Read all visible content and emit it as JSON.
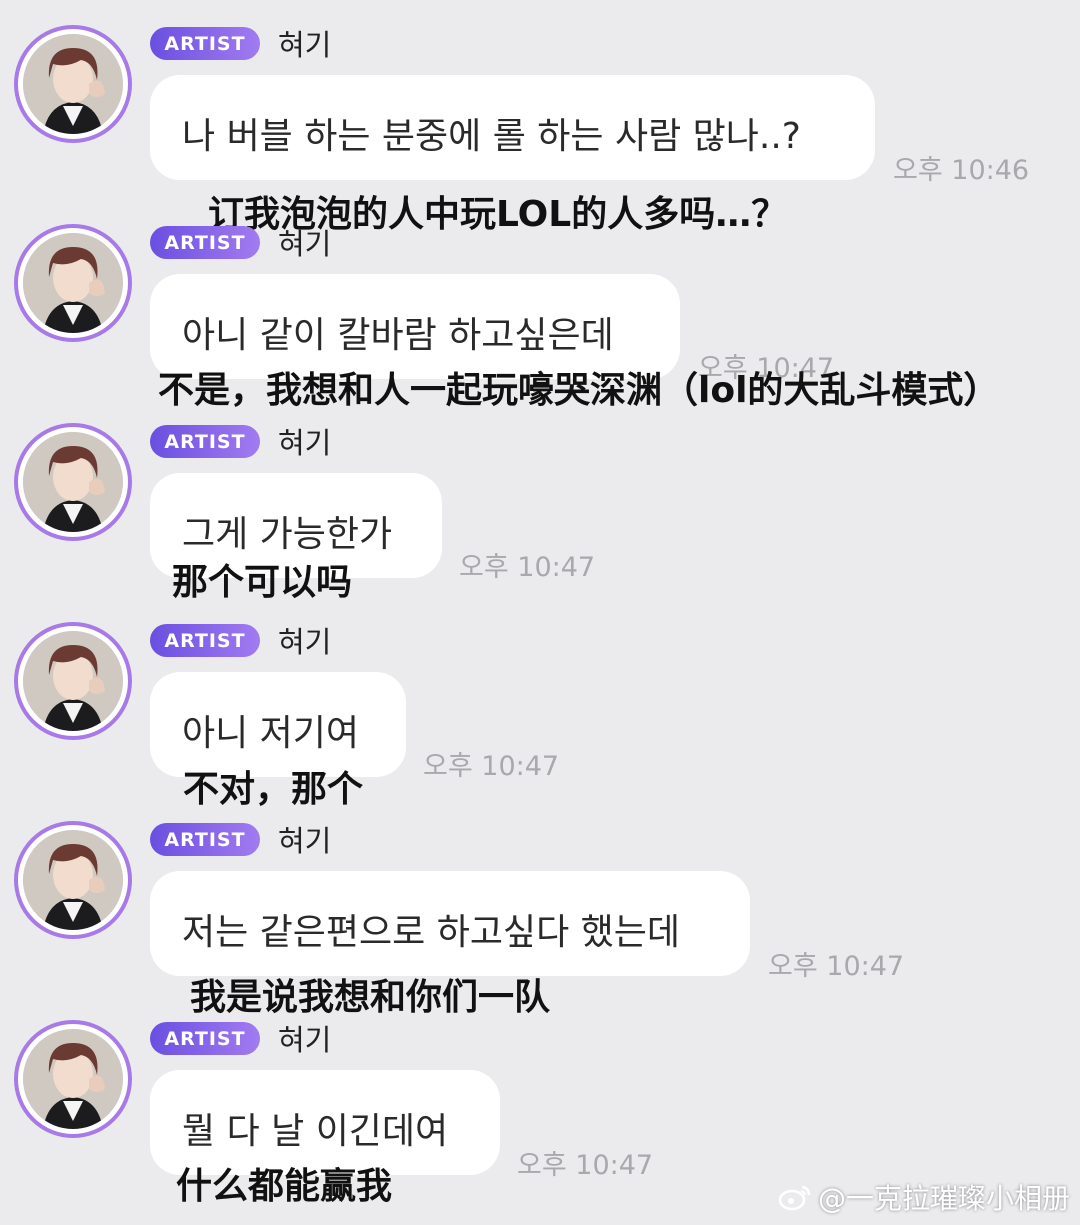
{
  "colors": {
    "badge_start": "#6a4fe0",
    "badge_end": "#a27bf0",
    "avatar_ring": "#a77ae8",
    "background": "#ebebee"
  },
  "messages": [
    {
      "badge": "ARTIST",
      "name": "혀기",
      "text": "나 버블 하는 분중에 롤 하는 사람 많나..?",
      "time": "오후 10:46",
      "translation": "订我泡泡的人中玩LOL的人多吗…？"
    },
    {
      "badge": "ARTIST",
      "name": "혀기",
      "text": "아니 같이 칼바람 하고싶은데",
      "time": "오후 10:47",
      "translation": "不是，我想和人一起玩嚎哭深渊（lol的大乱斗模式）"
    },
    {
      "badge": "ARTIST",
      "name": "혀기",
      "text": "그게 가능한가",
      "time": "오후 10:47",
      "translation": "那个可以吗"
    },
    {
      "badge": "ARTIST",
      "name": "혀기",
      "text": "아니 저기여",
      "time": "오후 10:47",
      "translation": "不对，那个"
    },
    {
      "badge": "ARTIST",
      "name": "혀기",
      "text": "저는 같은편으로 하고싶다 했는데",
      "time": "오후 10:47",
      "translation": "我是说我想和你们一队"
    },
    {
      "badge": "ARTIST",
      "name": "혀기",
      "text": "뭘 다 날 이긴데여",
      "time": "오후 10:47",
      "translation": "什么都能赢我"
    }
  ],
  "watermark": {
    "icon": "weibo-icon",
    "text": "@一克拉璀璨小相册"
  }
}
